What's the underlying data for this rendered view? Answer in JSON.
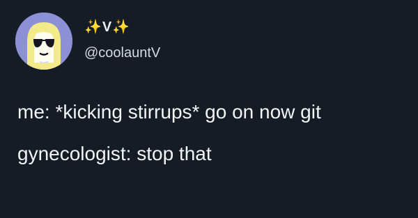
{
  "profile": {
    "display_name": "✨V✨",
    "handle": "@coolauntV",
    "avatar_icon": "blonde-woman-sunglasses-illustration",
    "avatar_background": "#8c91d6"
  },
  "tweet": {
    "lines": [
      "me: *kicking stirrups* go on now git",
      "gynecologist: stop that"
    ]
  },
  "theme": {
    "background": "#151c26",
    "text": "#f2f4f6"
  }
}
